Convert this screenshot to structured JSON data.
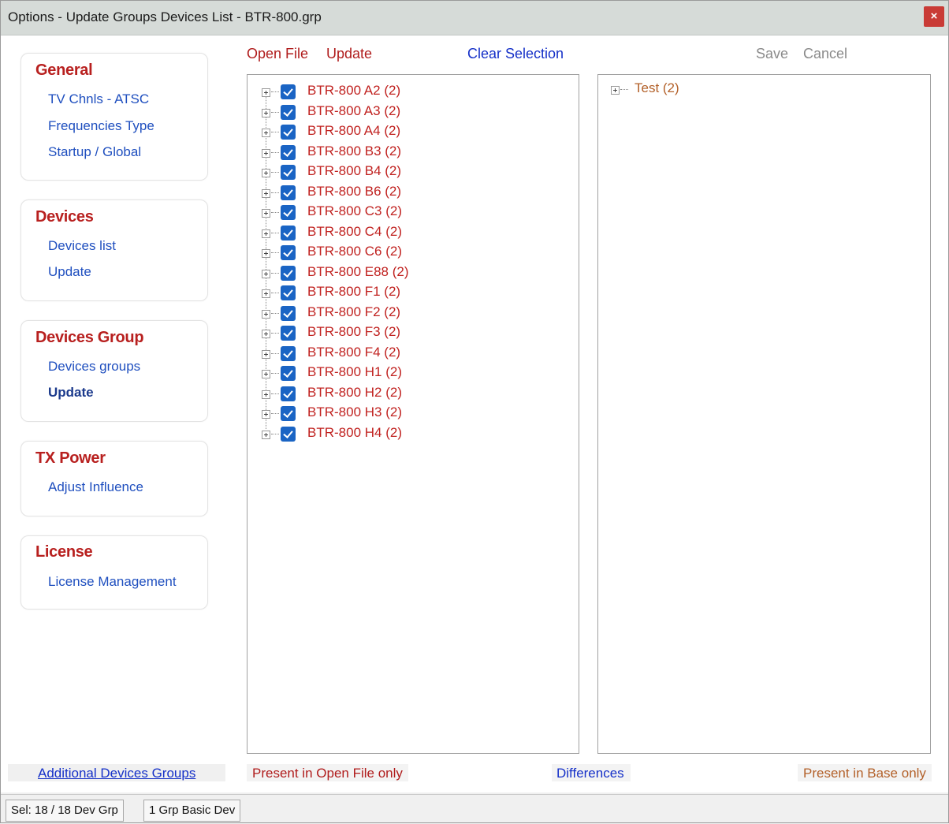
{
  "window": {
    "title": "Options - Update Groups Devices List  -  BTR-800.grp",
    "close_glyph": "×"
  },
  "sidebar": {
    "sections": [
      {
        "header": "General",
        "items": [
          "TV Chnls - ATSC",
          "Frequencies Type",
          "Startup / Global"
        ]
      },
      {
        "header": "Devices",
        "items": [
          "Devices list",
          "Update"
        ]
      },
      {
        "header": "Devices Group",
        "items": [
          "Devices groups",
          "Update"
        ]
      },
      {
        "header": "TX Power",
        "items": [
          "Adjust Influence"
        ]
      },
      {
        "header": "License",
        "items": [
          "License Management"
        ]
      }
    ],
    "active_item": "Devices Group > Update"
  },
  "toolbar": {
    "open_file": "Open File",
    "update": "Update",
    "clear_selection": "Clear Selection",
    "save": "Save",
    "cancel": "Cancel"
  },
  "left_tree": {
    "items": [
      {
        "label": "BTR-800 A2  (2)",
        "checked": true
      },
      {
        "label": "BTR-800 A3  (2)",
        "checked": true
      },
      {
        "label": "BTR-800 A4  (2)",
        "checked": true
      },
      {
        "label": "BTR-800 B3  (2)",
        "checked": true
      },
      {
        "label": "BTR-800 B4  (2)",
        "checked": true
      },
      {
        "label": "BTR-800 B6  (2)",
        "checked": true
      },
      {
        "label": "BTR-800 C3  (2)",
        "checked": true
      },
      {
        "label": "BTR-800 C4  (2)",
        "checked": true
      },
      {
        "label": "BTR-800 C6  (2)",
        "checked": true
      },
      {
        "label": "BTR-800 E88  (2)",
        "checked": true
      },
      {
        "label": "BTR-800 F1  (2)",
        "checked": true
      },
      {
        "label": "BTR-800 F2  (2)",
        "checked": true
      },
      {
        "label": "BTR-800 F3  (2)",
        "checked": true
      },
      {
        "label": "BTR-800 F4  (2)",
        "checked": true
      },
      {
        "label": "BTR-800 H1  (2)",
        "checked": true
      },
      {
        "label": "BTR-800 H2  (2)",
        "checked": true
      },
      {
        "label": "BTR-800 H3  (2)",
        "checked": true
      },
      {
        "label": "BTR-800 H4  (2)",
        "checked": true
      }
    ]
  },
  "right_tree": {
    "items": [
      {
        "label": "Test  (2)"
      }
    ]
  },
  "footer": {
    "additional_groups": "Additional Devices Groups",
    "present_open_only": "Present in Open File only",
    "differences": "Differences",
    "present_base_only": "Present in Base only"
  },
  "status": {
    "selection": "Sel: 18 / 18 Dev Grp",
    "basic": "1 Grp Basic Dev"
  },
  "colors": {
    "header_red": "#b8201f",
    "link_blue": "#1f4fbf",
    "tree_red": "#c0211f",
    "base_brown": "#b3612a",
    "check_blue": "#1a64c4"
  }
}
